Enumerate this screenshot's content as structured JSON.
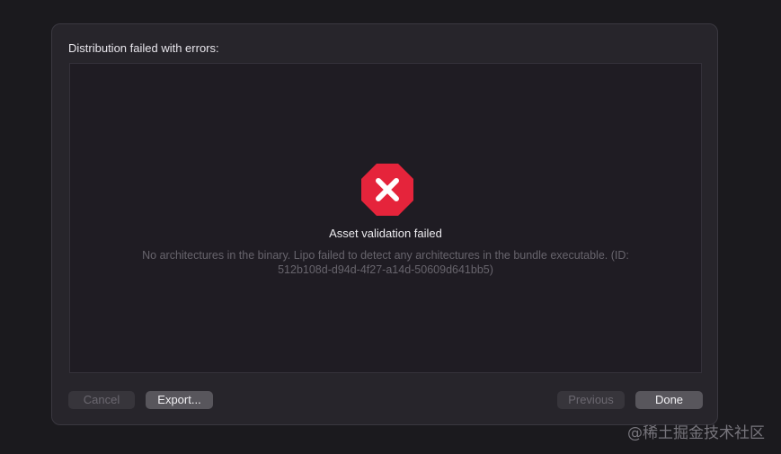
{
  "dialog": {
    "title": "Distribution failed with errors:",
    "error": {
      "icon": "error-octagon-icon",
      "icon_color": "#e5243b",
      "title": "Asset validation failed",
      "detail_line1": "No architectures in the binary. Lipo failed to detect any architectures in the bundle executable. (ID:",
      "detail_line2": "512b108d-d94d-4f27-a14d-50609d641bb5)"
    },
    "buttons": {
      "cancel": "Cancel",
      "export": "Export...",
      "previous": "Previous",
      "done": "Done"
    }
  },
  "watermark": "@稀土掘金技术社区"
}
